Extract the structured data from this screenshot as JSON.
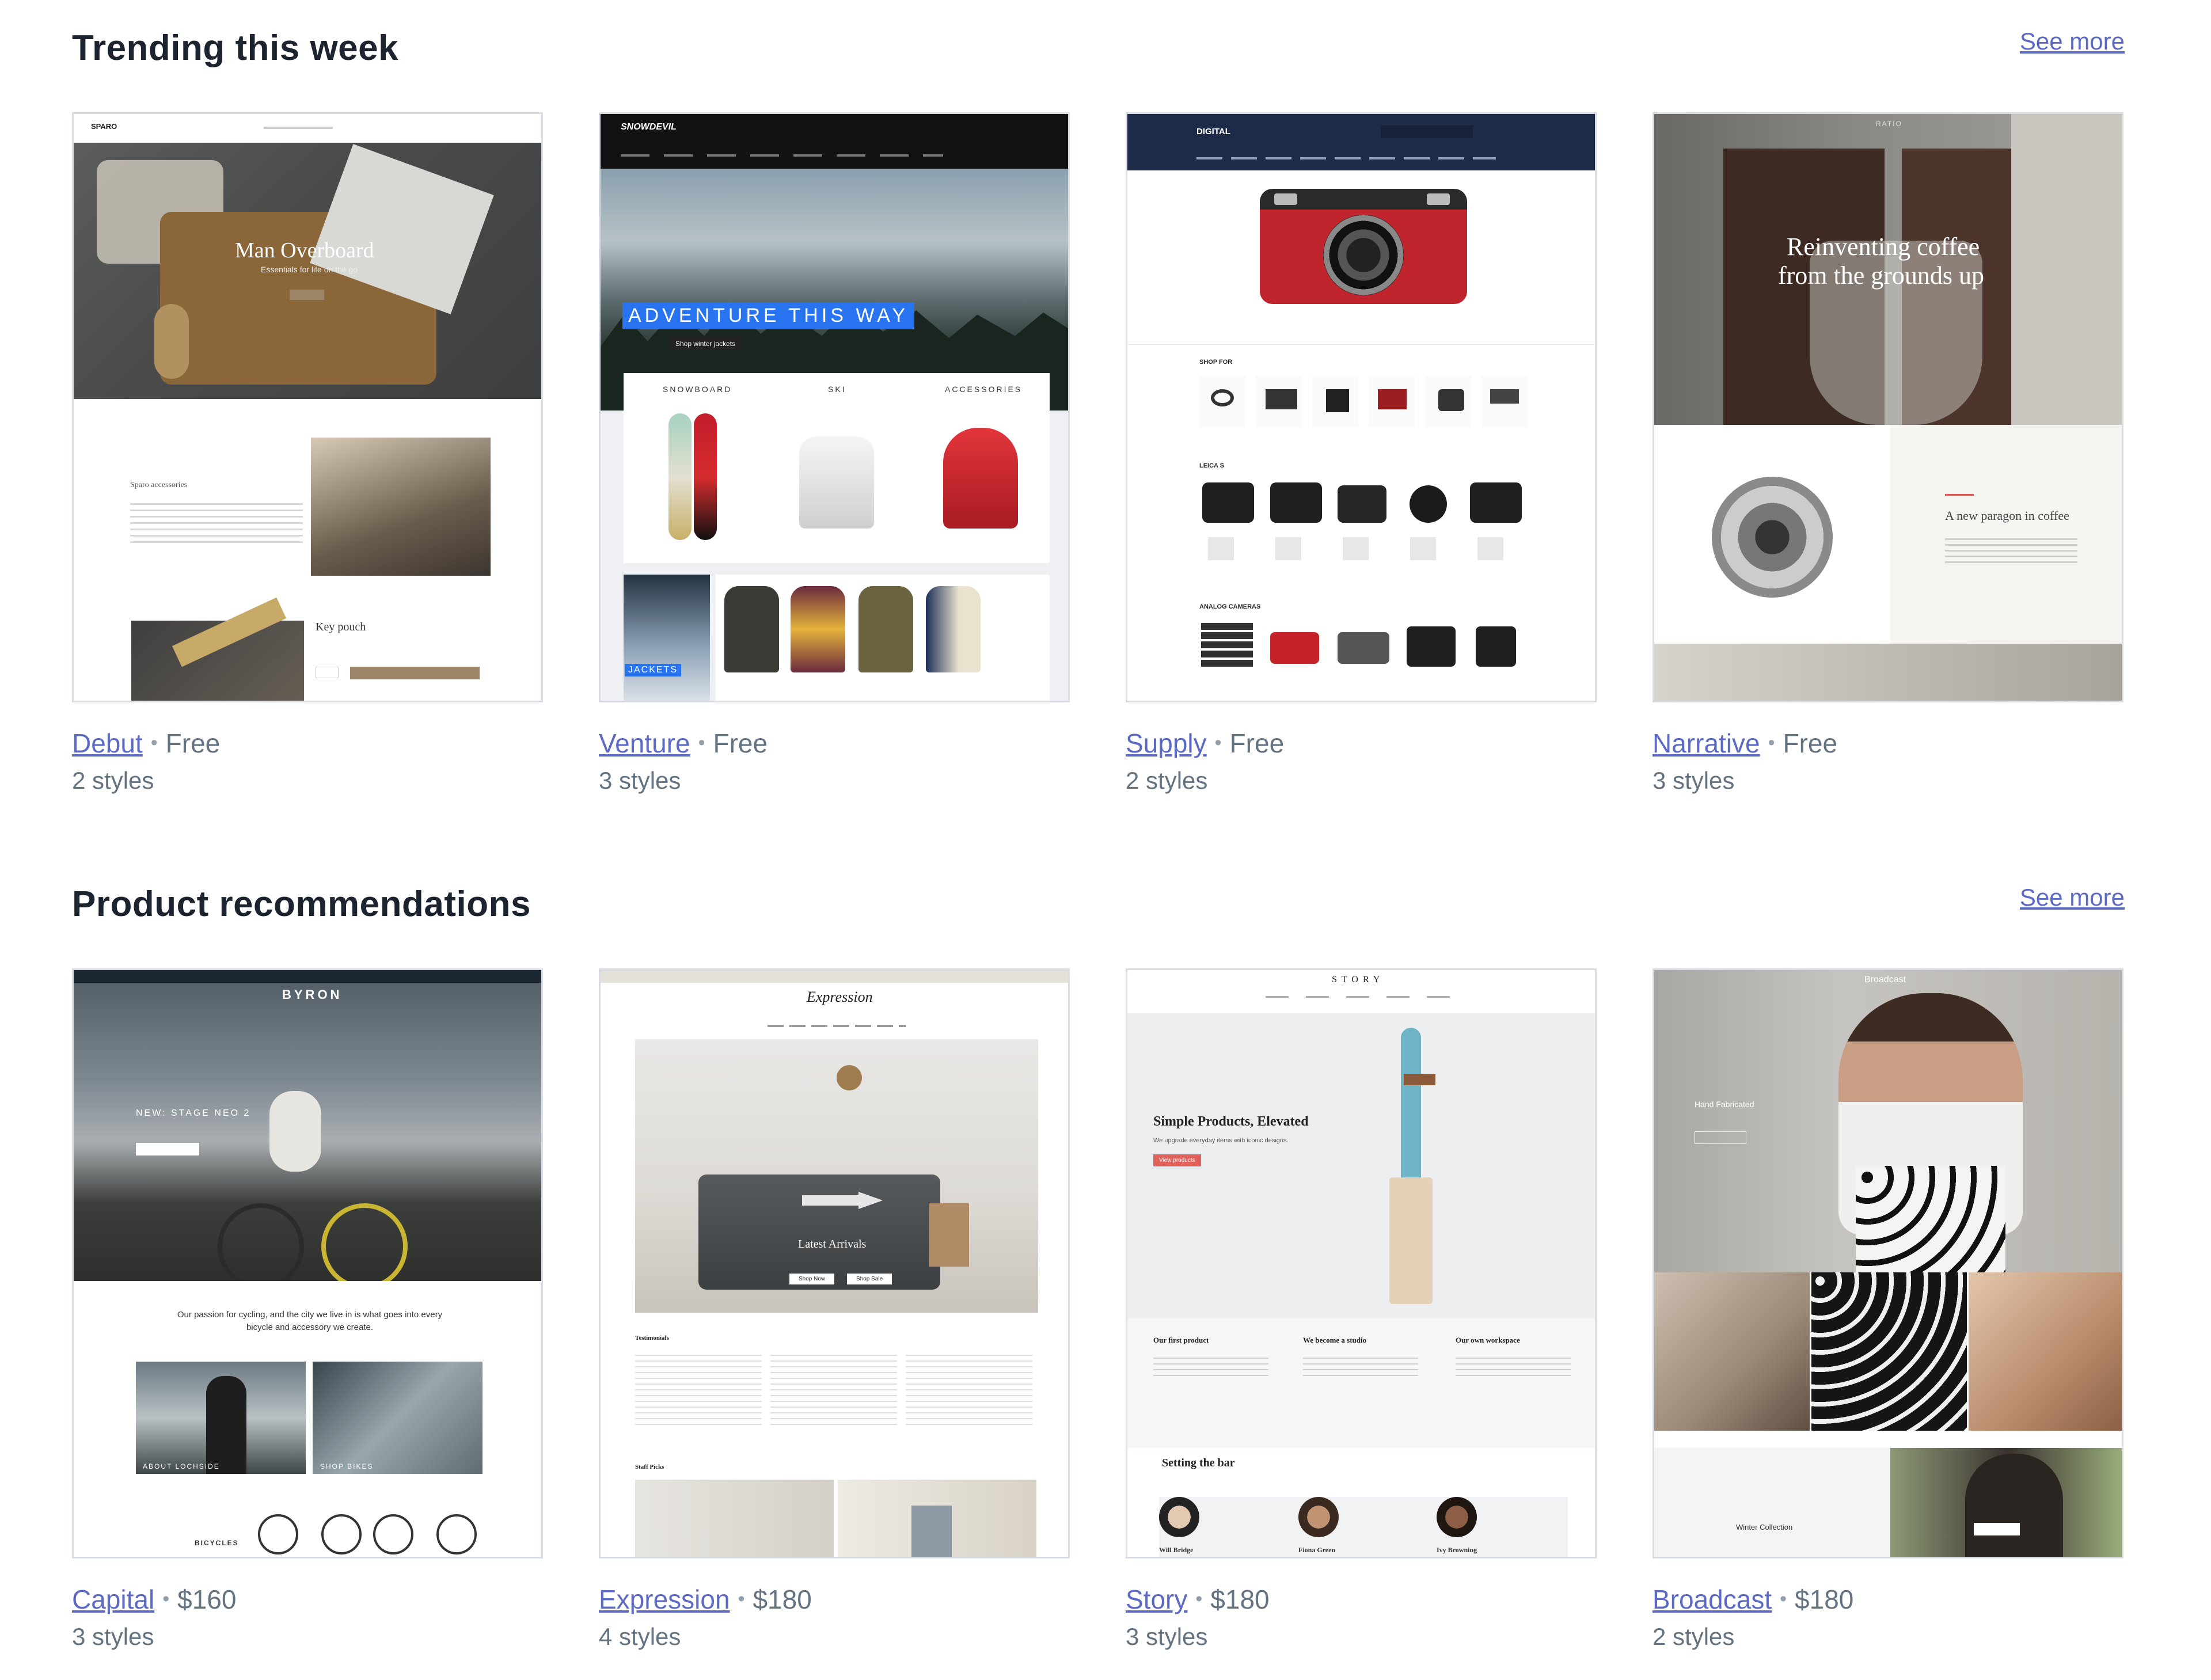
{
  "sections": [
    {
      "title": "Trending this week",
      "see_more": "See more",
      "cards": [
        {
          "name": "Debut",
          "price": "Free",
          "styles": "2 styles",
          "preview": {
            "brand": "SPARO",
            "hero": "Man Overboard",
            "hero_sub": "Essentials for life on the go",
            "block_title": "Sparo accessories",
            "product": "Key pouch"
          }
        },
        {
          "name": "Venture",
          "price": "Free",
          "styles": "3 styles",
          "preview": {
            "brand": "SNOWDEVIL",
            "hero": "ADVENTURE THIS WAY",
            "cta": "Shop winter jackets",
            "cats": [
              "SNOWBOARD",
              "SKI",
              "ACCESSORIES"
            ],
            "promo": "JACKETS"
          }
        },
        {
          "name": "Supply",
          "price": "Free",
          "styles": "2 styles",
          "preview": {
            "brand": "DIGITAL",
            "shop_for": "SHOP FOR",
            "row1": "LEICA S",
            "row2": "ANALOG CAMERAS"
          }
        },
        {
          "name": "Narrative",
          "price": "Free",
          "styles": "3 styles",
          "preview": {
            "brand": "RATIO",
            "hero": "Reinventing coffee",
            "hero2": "from the grounds up",
            "tagline": "A new paragon in coffee"
          }
        }
      ]
    },
    {
      "title": "Product recommendations",
      "see_more": "See more",
      "cards": [
        {
          "name": "Capital",
          "price": "$160",
          "styles": "3 styles",
          "preview": {
            "brand": "BYRON",
            "hero": "NEW: STAGE NEO 2",
            "body": "Our passion for cycling, and the city we live in is what goes into every bicycle and accessory we create.",
            "tile1": "ABOUT LOCHSIDE",
            "tile2": "SHOP BIKES",
            "bottom": "BICYCLES"
          }
        },
        {
          "name": "Expression",
          "price": "$180",
          "styles": "4 styles",
          "preview": {
            "brand": "Expression",
            "hero": "Latest Arrivals",
            "btn1": "Shop Now",
            "btn2": "Shop Sale",
            "testimonials": "Testimonials",
            "staff": "Staff Picks"
          }
        },
        {
          "name": "Story",
          "price": "$180",
          "styles": "3 styles",
          "preview": {
            "brand": "STORY",
            "hero": "Simple Products, Elevated",
            "hero_sub": "We upgrade everyday items with iconic designs.",
            "cta": "View products",
            "col1": "Our first product",
            "col2": "We become a studio",
            "col3": "Our own workspace",
            "section": "Setting the bar",
            "p1": "Will Bridge",
            "p2": "Fiona Green",
            "p3": "Ivy Browning"
          }
        },
        {
          "name": "Broadcast",
          "price": "$180",
          "styles": "2 styles",
          "preview": {
            "brand": "Broadcast",
            "hero": "Hand Fabricated",
            "label": "Winter Collection"
          }
        }
      ]
    }
  ],
  "separator": "•"
}
